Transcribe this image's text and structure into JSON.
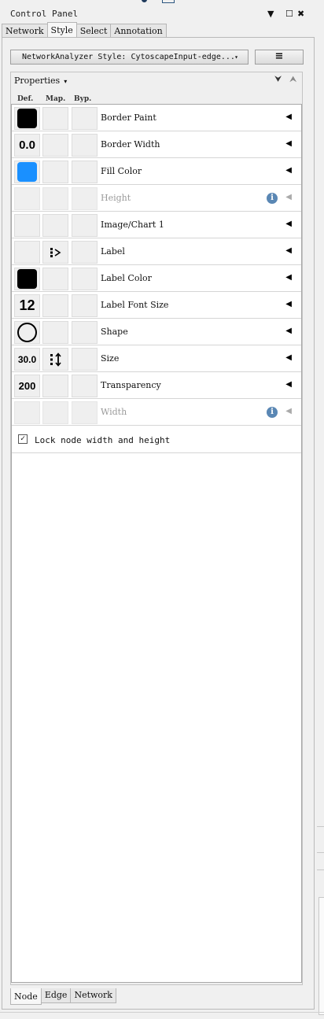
{
  "panel": {
    "title": "Control Panel",
    "dropdown_icon": "caret-down-icon",
    "maximize_icon": "maximize-icon",
    "close_icon": "close-icon"
  },
  "top_tabs": [
    "Network",
    "Style",
    "Select",
    "Annotation"
  ],
  "active_top_tab": "Style",
  "style_selector": {
    "value": "NetworkAnalyzer Style: CytoscapeInput-edge...",
    "caret": "▾"
  },
  "menu_button": {
    "icon": "hamburger-icon",
    "glyph": "≡"
  },
  "properties": {
    "label": "Properties",
    "caret": "▾",
    "expand_icon": "⮟",
    "collapse_icon": "⮝",
    "columns": [
      "Def.",
      "Map.",
      "Byp."
    ],
    "rows": [
      {
        "name": "Border Paint",
        "default": {
          "kind": "color",
          "color": "#000000"
        },
        "mapping": "",
        "disabled": false
      },
      {
        "name": "Border Width",
        "default": {
          "kind": "number",
          "text": "0.0"
        },
        "mapping": "",
        "disabled": false
      },
      {
        "name": "Fill Color",
        "default": {
          "kind": "color",
          "color": "#1a90ff"
        },
        "mapping": "",
        "disabled": false
      },
      {
        "name": "Height",
        "default": {
          "kind": "none"
        },
        "mapping": "",
        "disabled": true,
        "info": "i"
      },
      {
        "name": "Image/Chart 1",
        "default": {
          "kind": "none"
        },
        "mapping": "",
        "disabled": false
      },
      {
        "name": "Label",
        "default": {
          "kind": "none"
        },
        "mapping": "passthrough",
        "disabled": false
      },
      {
        "name": "Label Color",
        "default": {
          "kind": "color",
          "color": "#000000"
        },
        "mapping": "",
        "disabled": false
      },
      {
        "name": "Label Font Size",
        "default": {
          "kind": "number",
          "text": "12"
        },
        "mapping": "",
        "disabled": false
      },
      {
        "name": "Shape",
        "default": {
          "kind": "shape",
          "shape": "ellipse"
        },
        "mapping": "",
        "disabled": false
      },
      {
        "name": "Size",
        "default": {
          "kind": "number",
          "text": "30.0"
        },
        "mapping": "continuous",
        "disabled": false
      },
      {
        "name": "Transparency",
        "default": {
          "kind": "number",
          "text": "200"
        },
        "mapping": "",
        "disabled": false
      },
      {
        "name": "Width",
        "default": {
          "kind": "none"
        },
        "mapping": "",
        "disabled": true,
        "info": "i"
      }
    ],
    "arrow_glyph": "◀",
    "lock": {
      "label": "Lock node width and height",
      "checked": true,
      "check_glyph": "✓"
    }
  },
  "bottom_tabs": [
    "Node",
    "Edge",
    "Network"
  ],
  "active_bottom_tab": "Node"
}
